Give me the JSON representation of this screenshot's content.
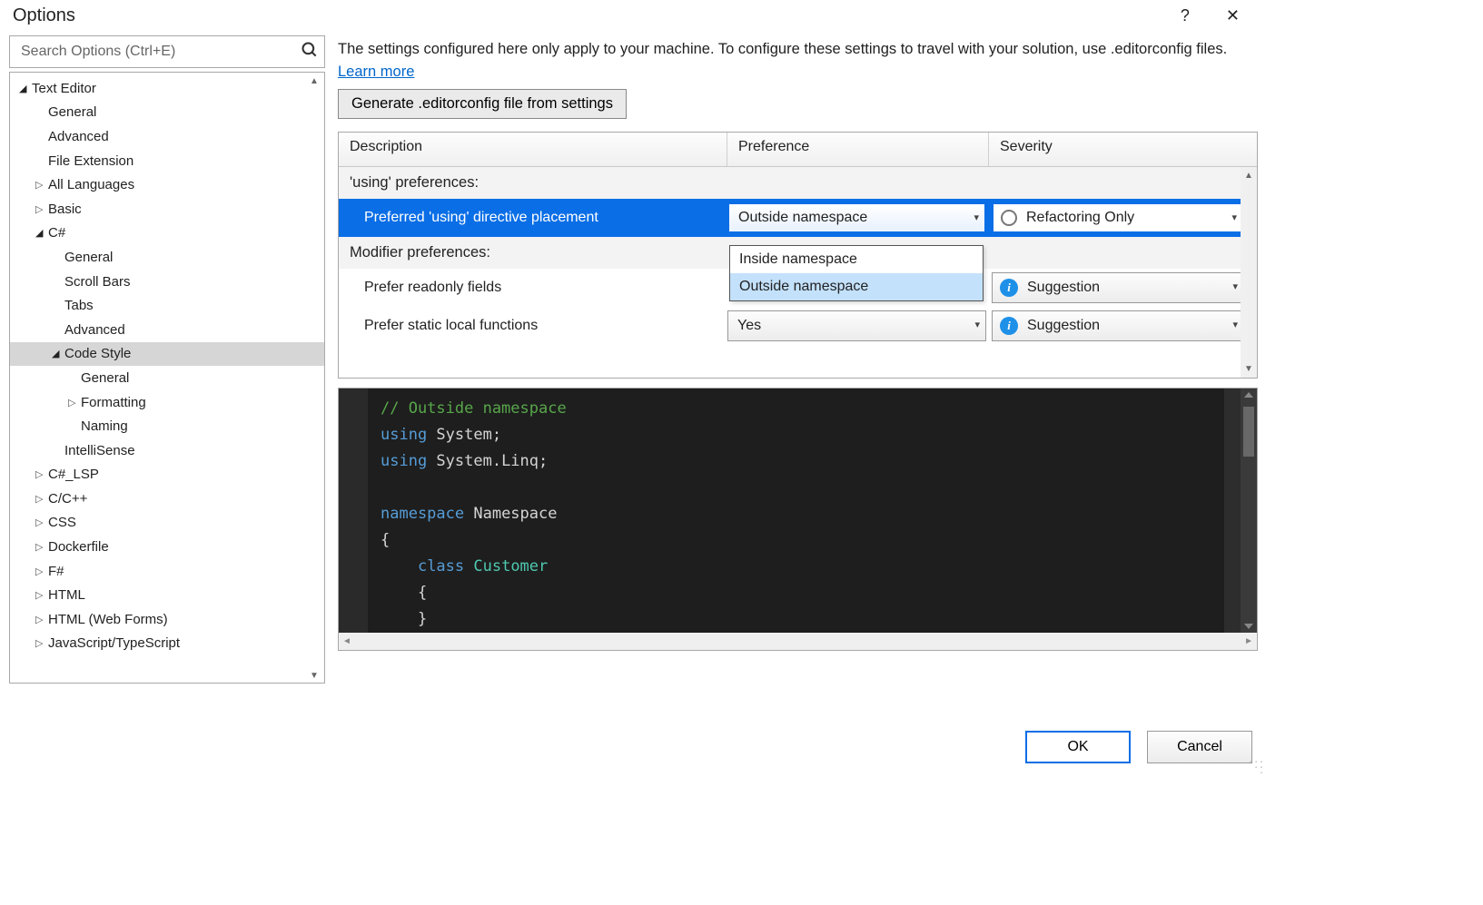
{
  "title": "Options",
  "search": {
    "placeholder": "Search Options (Ctrl+E)"
  },
  "tree": [
    {
      "label": "Text Editor",
      "indent": 0,
      "toggle": "open"
    },
    {
      "label": "General",
      "indent": 1,
      "toggle": ""
    },
    {
      "label": "Advanced",
      "indent": 1,
      "toggle": ""
    },
    {
      "label": "File Extension",
      "indent": 1,
      "toggle": ""
    },
    {
      "label": "All Languages",
      "indent": 1,
      "toggle": "closed"
    },
    {
      "label": "Basic",
      "indent": 1,
      "toggle": "closed"
    },
    {
      "label": "C#",
      "indent": 1,
      "toggle": "open"
    },
    {
      "label": "General",
      "indent": 2,
      "toggle": ""
    },
    {
      "label": "Scroll Bars",
      "indent": 2,
      "toggle": ""
    },
    {
      "label": "Tabs",
      "indent": 2,
      "toggle": ""
    },
    {
      "label": "Advanced",
      "indent": 2,
      "toggle": ""
    },
    {
      "label": "Code Style",
      "indent": 2,
      "toggle": "open",
      "selected": true
    },
    {
      "label": "General",
      "indent": 3,
      "toggle": ""
    },
    {
      "label": "Formatting",
      "indent": 3,
      "toggle": "closed"
    },
    {
      "label": "Naming",
      "indent": 3,
      "toggle": ""
    },
    {
      "label": "IntelliSense",
      "indent": 2,
      "toggle": ""
    },
    {
      "label": "C#_LSP",
      "indent": 1,
      "toggle": "closed"
    },
    {
      "label": "C/C++",
      "indent": 1,
      "toggle": "closed"
    },
    {
      "label": "CSS",
      "indent": 1,
      "toggle": "closed"
    },
    {
      "label": "Dockerfile",
      "indent": 1,
      "toggle": "closed"
    },
    {
      "label": "F#",
      "indent": 1,
      "toggle": "closed"
    },
    {
      "label": "HTML",
      "indent": 1,
      "toggle": "closed"
    },
    {
      "label": "HTML (Web Forms)",
      "indent": 1,
      "toggle": "closed"
    },
    {
      "label": "JavaScript/TypeScript",
      "indent": 1,
      "toggle": "closed"
    }
  ],
  "info": {
    "text": "The settings configured here only apply to your machine. To configure these settings to travel with your solution, use .editorconfig files.  ",
    "link": "Learn more"
  },
  "gen_button": "Generate .editorconfig file from settings",
  "grid": {
    "headers": {
      "desc": "Description",
      "pref": "Preference",
      "sev": "Severity"
    },
    "group1": "'using' preferences:",
    "row1": {
      "desc": "Preferred 'using' directive placement",
      "pref": "Outside namespace",
      "sev": "Refactoring Only"
    },
    "group2": "Modifier preferences:",
    "row2": {
      "desc": "Prefer readonly fields",
      "pref": "",
      "sev": "Suggestion"
    },
    "row3": {
      "desc": "Prefer static local functions",
      "pref": "Yes",
      "sev": "Suggestion"
    },
    "dropdown_options": [
      "Inside namespace",
      "Outside namespace"
    ]
  },
  "code_preview": {
    "comment": "// Outside namespace",
    "using1_kw": "using",
    "using1_rest": " System;",
    "using2_kw": "using",
    "using2_rest": " System.Linq;",
    "ns_kw": "namespace",
    "ns_rest": " Namespace",
    "brace_open": "{",
    "class_kw": "class ",
    "class_type": "Customer",
    "brace_open2": "    {",
    "brace_close2": "    }"
  },
  "buttons": {
    "ok": "OK",
    "cancel": "Cancel"
  }
}
